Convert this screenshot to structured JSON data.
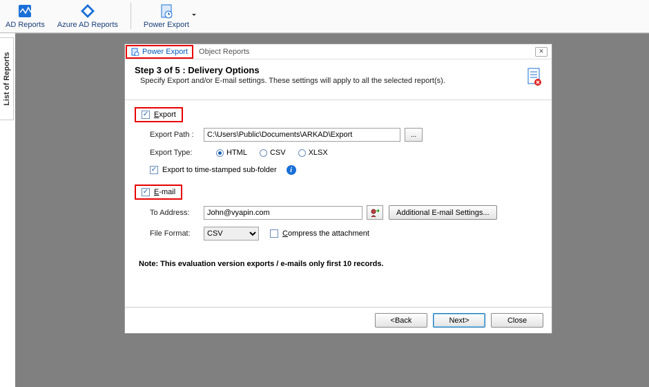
{
  "ribbon": {
    "ad_reports": "AD Reports",
    "azure_reports": "Azure AD Reports",
    "power_export": "Power Export"
  },
  "side_tab": "List of Reports",
  "dialog": {
    "title_active": "Power Export",
    "title_secondary": "Object Reports",
    "close_glyph": "✕",
    "step_title": "Step 3 of 5  : Delivery Options",
    "step_subtitle": "Specify Export and/or E-mail settings. These settings will apply to all the selected report(s).",
    "export_section": {
      "label_pre": "E",
      "label_rest": "xport",
      "path_label": "Export Path :",
      "path_value": "C:\\Users\\Public\\Documents\\ARKAD\\Export",
      "browse_label": "...",
      "type_label": "Export Type:",
      "html": "HTML",
      "csv": "CSV",
      "xlsx": "XLSX",
      "timestamped_label": "Export to time-stamped sub-folder"
    },
    "email_section": {
      "label_pre": "E",
      "label_rest": "-mail",
      "to_label": "To Address:",
      "to_value": "John@vyapin.com",
      "additional_btn": "Additional E-mail Settings...",
      "format_label": "File Format:",
      "format_value": "CSV",
      "compress_pre": "C",
      "compress_rest": "ompress the attachment"
    },
    "note": "Note:  This evaluation version exports / e-mails only first 10 records.",
    "footer": {
      "back": "<Back",
      "next": "Next>",
      "close": "Close"
    }
  }
}
